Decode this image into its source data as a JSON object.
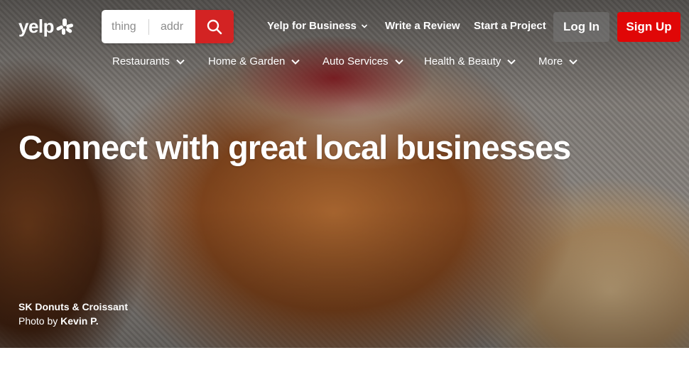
{
  "header": {
    "logo_text": "yelp",
    "logo_icon": "yelp-burst-icon",
    "search": {
      "find_placeholder": "thing",
      "near_placeholder": "addr",
      "button_icon": "search-icon"
    },
    "nav": {
      "yelp_for_business": "Yelp for Business",
      "write_review": "Write a Review",
      "start_project": "Start a Project",
      "login": "Log In",
      "signup": "Sign Up"
    }
  },
  "categories": [
    {
      "label": "Restaurants"
    },
    {
      "label": "Home & Garden"
    },
    {
      "label": "Auto Services"
    },
    {
      "label": "Health & Beauty"
    },
    {
      "label": "More"
    }
  ],
  "hero": {
    "headline": "Connect with great local businesses",
    "business_name": "SK Donuts & Croissant",
    "photo_by_prefix": "Photo by",
    "photographer": "Kevin P."
  },
  "colors": {
    "brand_red": "#d32323",
    "signup_red": "#e00707"
  }
}
